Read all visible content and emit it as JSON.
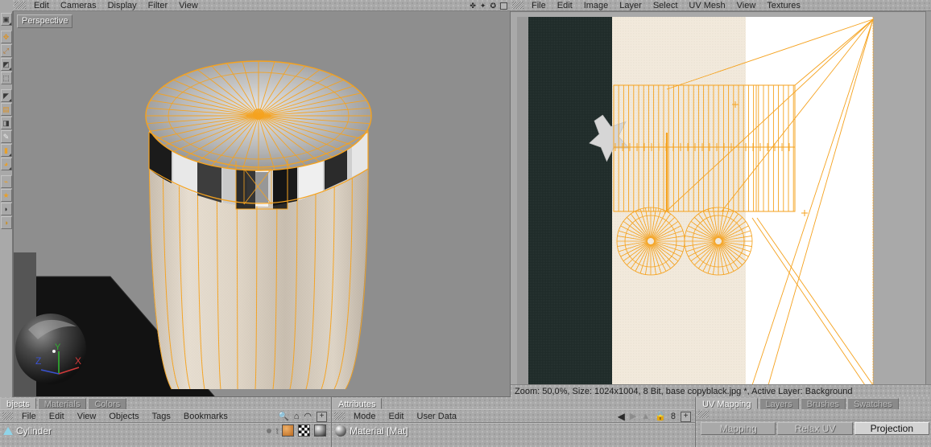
{
  "app": {
    "title": "Cinema 4D — BodyPaint UV Edit"
  },
  "viewport": {
    "menu": [
      "Edit",
      "Cameras",
      "Display",
      "Filter",
      "View"
    ],
    "label": "Perspective",
    "icons": [
      "camera-move-icon",
      "camera-pan-icon",
      "camera-rotate-icon",
      "maximize-icon"
    ],
    "axis": {
      "x": "X",
      "y": "Y",
      "z": "Z",
      "x_color": "#d03a3a",
      "y_color": "#2fb32f",
      "z_color": "#3a52d0"
    },
    "background_color": "#8e8e8e",
    "wire_color": "#f5a21e"
  },
  "uv_editor": {
    "menu": [
      "File",
      "Edit",
      "Image",
      "Layer",
      "Select",
      "UV Mesh",
      "View",
      "Textures"
    ],
    "status": "Zoom: 50,0%, Size: 1024x1004, 8 Bit, base copyblack.jpg *, Active Layer: Background",
    "zoom_value": "50,0%",
    "image_size": "1024x1004",
    "bit_depth": "8 Bit",
    "file_name": "base copyblack.jpg *",
    "active_layer": "Background",
    "texture": {
      "dark_band_color": "#1f2b29",
      "cream_band_color": "#f3e9dc",
      "white_band_color": "#ffffff",
      "star_color": "#d4d4d4"
    },
    "uv_wire_color": "#f5a21e"
  },
  "objects_panel": {
    "tabs": [
      {
        "label": "bjects",
        "active": true
      },
      {
        "label": "Materials",
        "active": false
      },
      {
        "label": "Colors",
        "active": false
      }
    ],
    "menu": [
      "File",
      "Edit",
      "View",
      "Objects",
      "Tags",
      "Bookmarks"
    ],
    "icons": [
      "search-icon",
      "home-icon",
      "eye-icon",
      "add-box-icon"
    ],
    "rows": [
      {
        "name": "Cylinder",
        "icon": "cone-object-icon"
      }
    ]
  },
  "attributes_panel": {
    "tabs": [
      {
        "label": "Attributes",
        "active": true
      }
    ],
    "menu": [
      "Mode",
      "Edit",
      "User Data"
    ],
    "icons": [
      "back-arrow-icon",
      "forward-arrow-icon",
      "up-arrow-icon",
      "lock-icon",
      "add-box-icon"
    ],
    "count": "8",
    "rows": [
      {
        "name": "Material [Mat]",
        "icon": "material-sphere-icon"
      }
    ]
  },
  "uv_mapping_panel": {
    "tabs": [
      {
        "label": "UV Mapping",
        "active": true
      },
      {
        "label": "Layers",
        "active": false
      },
      {
        "label": "Brushes",
        "active": false
      },
      {
        "label": "Swatches",
        "active": false
      }
    ],
    "subtabs": [
      {
        "label": "Mapping",
        "active": false
      },
      {
        "label": "Relax UV",
        "active": false
      },
      {
        "label": "Projection",
        "active": true
      }
    ]
  },
  "left_toolstrip": {
    "tools": [
      "selection-tool-icon",
      "move-tool-icon",
      "scale-tool-icon",
      "rotate-tool-icon",
      "undo-tool-icon",
      "world-axis-icon",
      "points-mode-icon",
      "edges-mode-icon",
      "polygons-mode-icon",
      "texture-mode-icon",
      "axis-mode-icon",
      "brush-tool-icon",
      "fill-tool-icon",
      "paint-tool-icon",
      "uv-tool-icon",
      "layer-tool-icon"
    ]
  }
}
